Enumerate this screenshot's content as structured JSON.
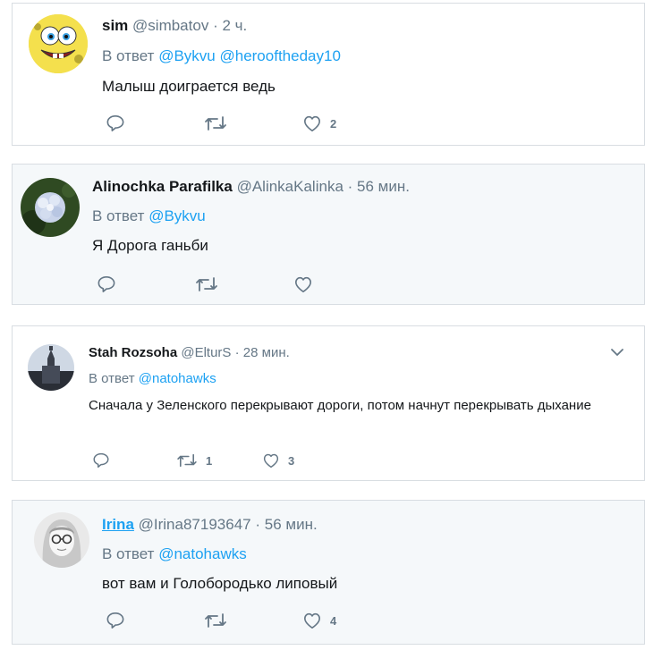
{
  "tweets": [
    {
      "name": "sim",
      "handle": "@simbatov",
      "dot": "·",
      "time": "2 ч.",
      "reply_prefix": "В ответ",
      "mentions": [
        "@Bykvu",
        "@herooftheday10"
      ],
      "text": "Малыш доиграется ведь",
      "retweets": "",
      "likes": "2",
      "avatar_icon": "spongebob-avatar"
    },
    {
      "name": "Alinochka Parafilka",
      "handle": "@AlinkaKalinka",
      "dot": "·",
      "time": "56 мин.",
      "reply_prefix": "В ответ",
      "mentions": [
        "@Bykvu"
      ],
      "text": "Я Дорога ганьби",
      "retweets": "",
      "likes": "",
      "avatar_icon": "hydrangea-avatar"
    },
    {
      "name": "Stah Rozsoha",
      "handle": "@ElturS",
      "dot": "·",
      "time": "28 мин.",
      "reply_prefix": "В ответ",
      "mentions": [
        "@natohawks"
      ],
      "text": "Сначала у Зеленского перекрывают дороги, потом начнут перекрывать дыхание",
      "retweets": "1",
      "likes": "3",
      "avatar_icon": "church-avatar"
    },
    {
      "name": "Irina",
      "handle": "@Irina87193647",
      "dot": "·",
      "time": "56 мин.",
      "reply_prefix": "В ответ",
      "mentions": [
        "@natohawks"
      ],
      "text": "вот вам и Голобородько липовый",
      "retweets": "",
      "likes": "4",
      "avatar_icon": "woman-sketch-avatar"
    }
  ],
  "colors": {
    "link": "#1da1f2",
    "muted": "#657786",
    "border": "#d8dde2",
    "highlight_bg": "#f5f8fa"
  }
}
